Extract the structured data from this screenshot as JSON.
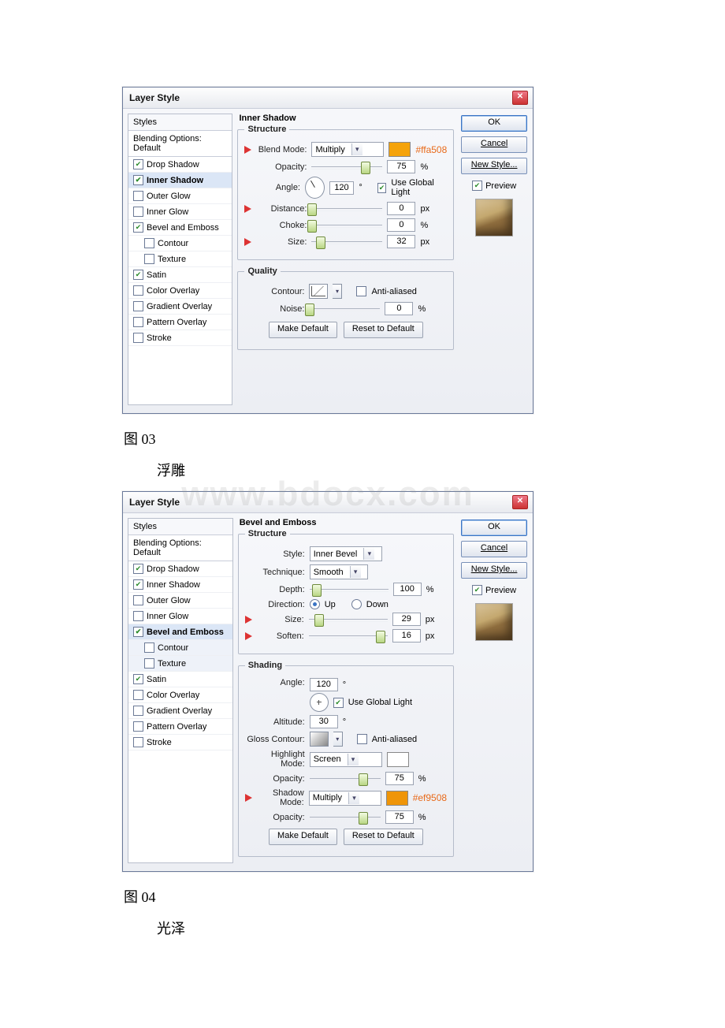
{
  "captions": {
    "fig03": "图 03",
    "emboss": "浮雕",
    "fig04": "图 04",
    "gloss": "光泽"
  },
  "watermark": "www.bdocx.com",
  "styles_list": {
    "header": "Styles",
    "blending": "Blending Options: Default",
    "drop_shadow": "Drop Shadow",
    "inner_shadow": "Inner Shadow",
    "outer_glow": "Outer Glow",
    "inner_glow": "Inner Glow",
    "bevel_emboss": "Bevel and Emboss",
    "contour": "Contour",
    "texture": "Texture",
    "satin": "Satin",
    "color_overlay": "Color Overlay",
    "gradient_overlay": "Gradient Overlay",
    "pattern_overlay": "Pattern Overlay",
    "stroke": "Stroke"
  },
  "buttons": {
    "ok": "OK",
    "cancel": "Cancel",
    "new_style": "New Style...",
    "preview": "Preview",
    "make_default": "Make Default",
    "reset_default": "Reset to Default"
  },
  "dialog1": {
    "title": "Layer Style",
    "group": "Inner Shadow",
    "structure": "Structure",
    "blend_mode_lbl": "Blend Mode:",
    "blend_mode_val": "Multiply",
    "color_hex": "#ffa508",
    "opacity_lbl": "Opacity:",
    "opacity_val": "75",
    "pct": "%",
    "angle_lbl": "Angle:",
    "angle_val": "120",
    "deg": "°",
    "use_global": "Use Global Light",
    "distance_lbl": "Distance:",
    "distance_val": "0",
    "px": "px",
    "choke_lbl": "Choke:",
    "choke_val": "0",
    "size_lbl": "Size:",
    "size_val": "32",
    "quality": "Quality",
    "contour_lbl": "Contour:",
    "antialiased": "Anti-aliased",
    "noise_lbl": "Noise:",
    "noise_val": "0"
  },
  "dialog2": {
    "title": "Layer Style",
    "group": "Bevel and Emboss",
    "structure": "Structure",
    "style_lbl": "Style:",
    "style_val": "Inner Bevel",
    "technique_lbl": "Technique:",
    "technique_val": "Smooth",
    "depth_lbl": "Depth:",
    "depth_val": "100",
    "pct": "%",
    "direction_lbl": "Direction:",
    "up": "Up",
    "down": "Down",
    "size_lbl": "Size:",
    "size_val": "29",
    "px": "px",
    "soften_lbl": "Soften:",
    "soften_val": "16",
    "shading": "Shading",
    "angle_lbl": "Angle:",
    "angle_val": "120",
    "deg": "°",
    "use_global": "Use Global Light",
    "altitude_lbl": "Altitude:",
    "altitude_val": "30",
    "gloss_contour_lbl": "Gloss Contour:",
    "antialiased": "Anti-aliased",
    "highlight_mode_lbl": "Highlight Mode:",
    "highlight_mode_val": "Screen",
    "hl_opacity_lbl": "Opacity:",
    "hl_opacity_val": "75",
    "shadow_mode_lbl": "Shadow Mode:",
    "shadow_mode_val": "Multiply",
    "shadow_color_hex": "#ef9508",
    "sh_opacity_lbl": "Opacity:",
    "sh_opacity_val": "75"
  }
}
